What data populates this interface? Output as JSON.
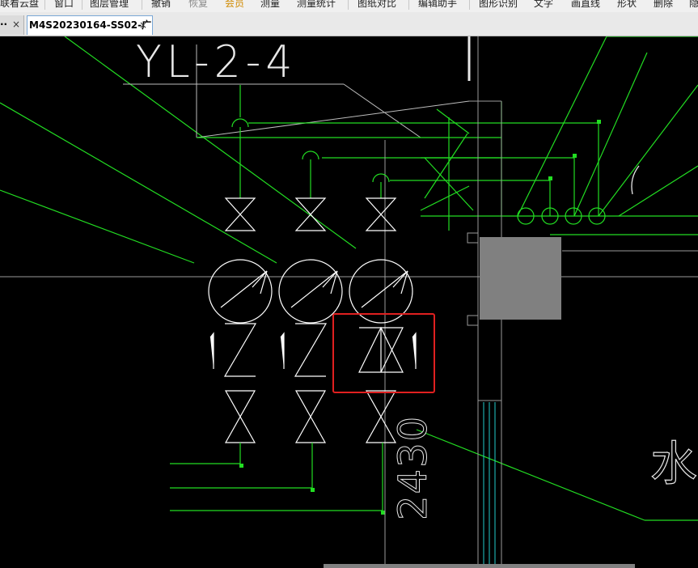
{
  "menubar": {
    "items": [
      {
        "label": "联看云盘",
        "state": "normal"
      },
      {
        "label": "窗口",
        "state": "normal"
      },
      {
        "label": "图层管理",
        "state": "normal"
      },
      {
        "label": "撤销",
        "state": "normal"
      },
      {
        "label": "恢复",
        "state": "disabled"
      },
      {
        "label": "会员",
        "state": "vip"
      },
      {
        "label": "测量",
        "state": "normal"
      },
      {
        "label": "测量统计",
        "state": "normal"
      },
      {
        "label": "图纸对比",
        "state": "normal"
      },
      {
        "label": "编辑助手",
        "state": "normal"
      },
      {
        "label": "图形识别",
        "state": "normal"
      },
      {
        "label": "文字",
        "state": "normal"
      },
      {
        "label": "画直线",
        "state": "normal"
      },
      {
        "label": "形状",
        "state": "normal"
      },
      {
        "label": "删除",
        "state": "normal"
      },
      {
        "label": "隐",
        "state": "normal"
      }
    ]
  },
  "tabs": {
    "prev": {
      "label": "··",
      "close": "×"
    },
    "active": {
      "label": "M4S20230164-SS02-广·",
      "close": "×"
    }
  },
  "drawing": {
    "pipe_label": "YL-2-4",
    "dimension_label": "2430",
    "partial_text": "水",
    "colors": {
      "background": "#000000",
      "pipe_green": "#22dd22",
      "outline_white": "#ffffff",
      "grid_gray": "#9a9a9a",
      "highlight_red": "#e02020",
      "block_gray": "#808080",
      "cyan": "#22cccc"
    }
  }
}
